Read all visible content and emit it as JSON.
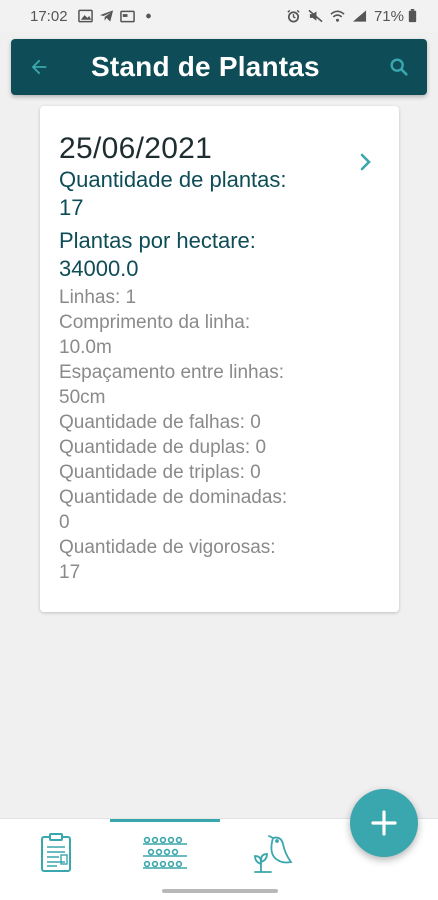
{
  "status_bar": {
    "time": "17:02",
    "battery_percent": "71%",
    "left_icons": [
      "image-icon",
      "telegram-icon",
      "calendar-icon",
      "dot-icon"
    ],
    "right_icons": [
      "alarm-icon",
      "mute-icon",
      "wifi-icon",
      "signal-icon",
      "battery-icon"
    ]
  },
  "app_bar": {
    "title": "Stand de Plantas",
    "back_icon": "arrow-left-icon",
    "search_icon": "search-icon",
    "background": "#0e4d57"
  },
  "card": {
    "date": "25/06/2021",
    "quantidade_plantas_label": "Quantidade de plantas:",
    "quantidade_plantas_value": "17",
    "plantas_hectare_label": "Plantas por hectare:",
    "plantas_hectare_value": "34000.0",
    "details": [
      "Linhas: 1",
      "Comprimento da linha:",
      "10.0m",
      "Espaçamento entre linhas:",
      "50cm",
      "Quantidade de falhas: 0",
      "Quantidade de duplas: 0",
      "Quantidade de triplas: 0",
      "Quantidade de dominadas:",
      "0",
      "Quantidade de vigorosas:",
      "17"
    ]
  },
  "bottom_nav": {
    "items": [
      {
        "icon": "clipboard-icon",
        "active": false
      },
      {
        "icon": "plant-rows-icon",
        "active": true
      },
      {
        "icon": "bird-plant-icon",
        "active": false
      }
    ]
  },
  "fab": {
    "icon": "plus-icon",
    "color": "#3aa6ad"
  }
}
